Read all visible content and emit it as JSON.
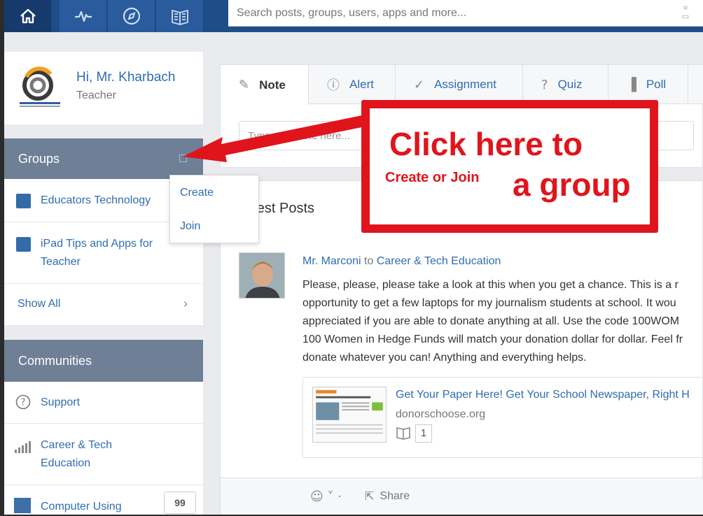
{
  "nav": {
    "items": [
      {
        "name": "home-icon"
      },
      {
        "name": "activity-icon"
      },
      {
        "name": "discover-icon"
      },
      {
        "name": "library-icon"
      }
    ]
  },
  "search": {
    "placeholder": "Search posts, groups, users, apps and more..."
  },
  "profile": {
    "greeting": "Hi, Mr. Kharbach",
    "role": "Teacher"
  },
  "groups": {
    "title": "Groups",
    "items": [
      {
        "label": "Educators Technology"
      },
      {
        "label_line1": "iPad Tips and Apps for",
        "label_line2": "Teacher"
      }
    ],
    "show_all": "Show All",
    "dropdown": {
      "create": "Create",
      "join": "Join"
    }
  },
  "communities": {
    "title": "Communities",
    "items": [
      {
        "label": "Support",
        "icon": "help-circle-icon"
      },
      {
        "label_line1": "Career & Tech",
        "label_line2": "Education",
        "icon": "bar-chart-icon"
      },
      {
        "label": "Computer Using",
        "badge": "99"
      }
    ]
  },
  "composer": {
    "tabs": [
      {
        "label": "Note",
        "icon": "note-icon"
      },
      {
        "label": "Alert",
        "icon": "alert-icon"
      },
      {
        "label": "Assignment",
        "icon": "check-icon"
      },
      {
        "label": "Quiz",
        "icon": "quiz-icon"
      },
      {
        "label": "Poll",
        "icon": "poll-icon"
      }
    ],
    "placeholder": "Type your note here..."
  },
  "feed": {
    "title": "Latest Posts",
    "post": {
      "author": "Mr. Marconi",
      "to": "to",
      "group": "Career & Tech Education",
      "lines": [
        "Please, please, please take a look at this when you get a chance. This is a r",
        "opportunity to get a few laptops for my journalism students at school. It wou",
        "appreciated if you are able to donate anything at all. Use the code 100WOM",
        "100 Women in Hedge Funds will match your donation dollar for dollar. Feel fr",
        "donate whatever you can! Anything and everything helps."
      ],
      "link_title": "Get Your Paper Here! Get Your School Newspaper, Right H",
      "link_domain": "donorschoose.org",
      "link_count": "1",
      "share": "Share"
    }
  },
  "annotation": {
    "line1": "Click here to",
    "small": "Create or Join",
    "line2": "a group",
    "color": "#e0151c"
  }
}
